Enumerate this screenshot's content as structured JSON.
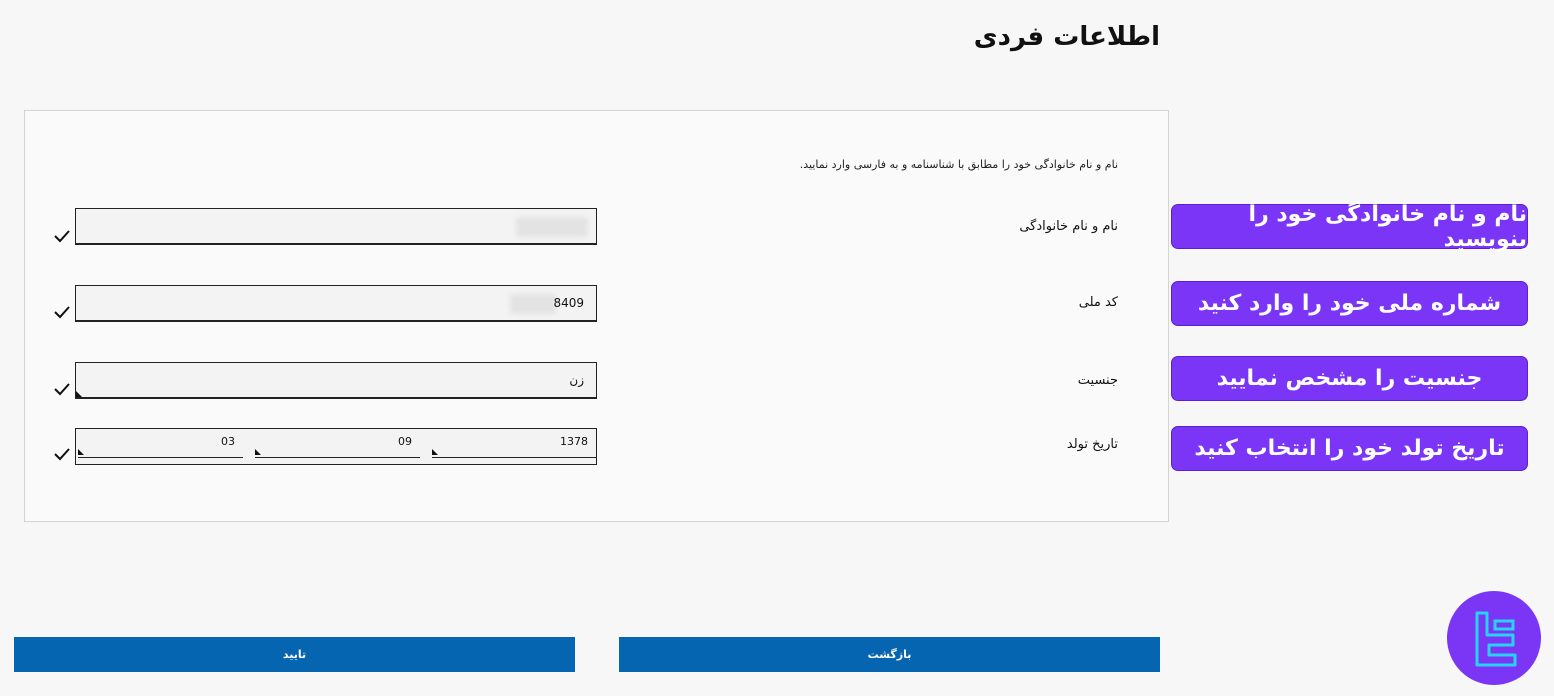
{
  "page": {
    "title": "اطلاعات فردی"
  },
  "form": {
    "instructions": "نام و نام خانوادگی خود را مطابق با شناسنامه و به فارسی وارد نمایید.",
    "full_name": {
      "label": "نام و نام خانوادگی",
      "value": ""
    },
    "national_code": {
      "label": "کد ملی",
      "value": "8409"
    },
    "gender": {
      "label": "جنسیت",
      "value": "زن"
    },
    "birth_date": {
      "label": "تاریخ تولد",
      "year": "1378",
      "month": "09",
      "day": "03"
    }
  },
  "callouts": [
    "نام و نام خانوادگی خود را بنویسید",
    "شماره ملی خود را وارد کنید",
    "جنسیت را مشخص نمایید",
    "تاریخ تولد خود را انتخاب کنید"
  ],
  "buttons": {
    "confirm": "تایید",
    "back": "بازگشت"
  },
  "colors": {
    "accent": "#7b35f6",
    "button": "#0565b0",
    "logo_stroke": "#27d3f2"
  },
  "icons": {
    "check": "check-icon",
    "logo": "brand-logo-icon"
  }
}
